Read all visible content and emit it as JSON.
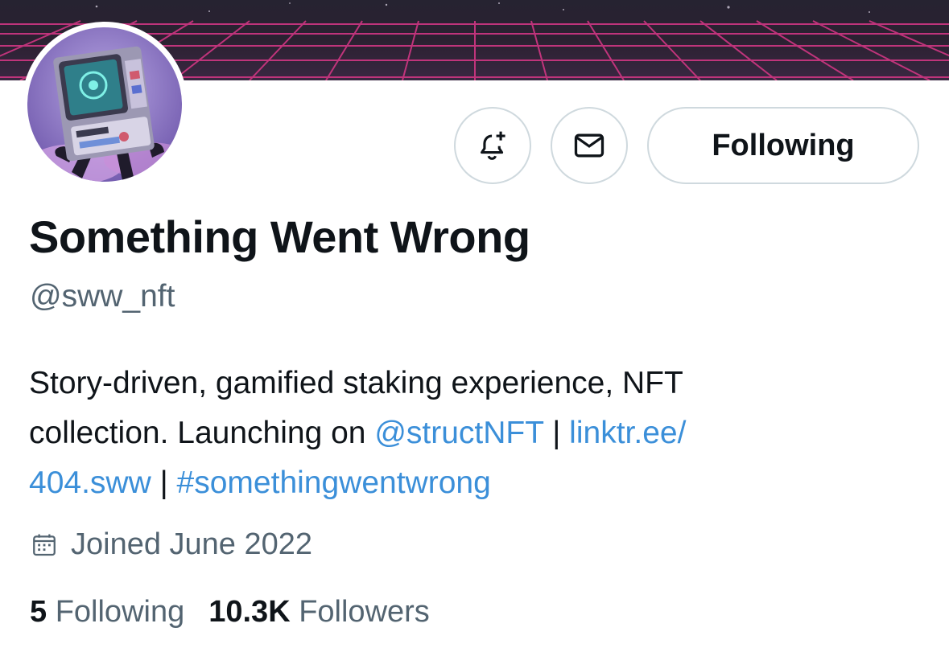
{
  "profile": {
    "display_name": "Something Went Wrong",
    "handle": "@sww_nft",
    "bio": {
      "line1": "Story-driven, gamified staking experience, NFT",
      "line2_prefix": "collection. Launching on ",
      "mention": "@structNFT",
      "separator1": " | ",
      "link_part1": "linktr.ee/",
      "link_part2": "404.sww",
      "separator2": " | ",
      "hashtag": "#somethingwentwrong"
    },
    "joined": "Joined June 2022",
    "stats": {
      "following_count": "5",
      "following_label": "Following",
      "followers_count": "10.3K",
      "followers_label": "Followers"
    }
  },
  "actions": {
    "follow_state_label": "Following",
    "notify_icon": "bell-plus-icon",
    "message_icon": "envelope-icon"
  },
  "colors": {
    "link": "#3b8fd9",
    "secondary_text": "#536471",
    "banner_grid": "#d63a8a"
  }
}
